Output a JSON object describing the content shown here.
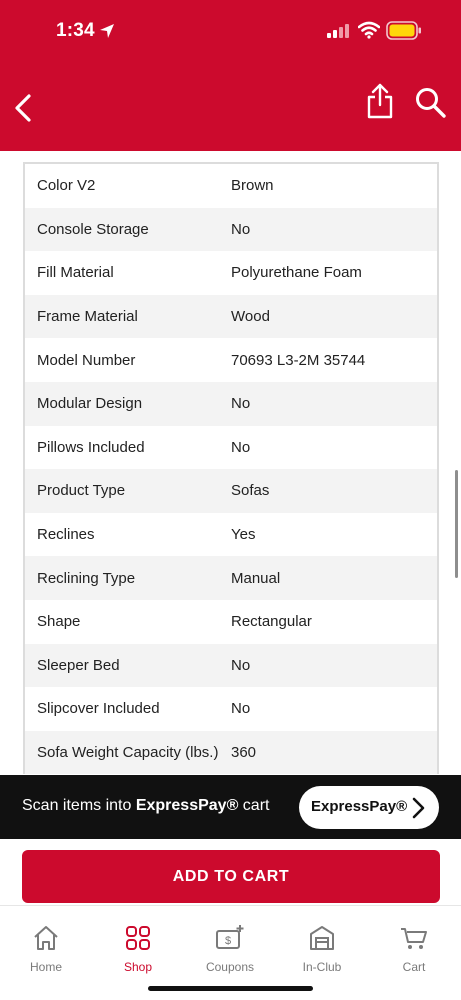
{
  "status_bar": {
    "time": "1:34"
  },
  "specs": [
    {
      "key": "Color V2",
      "value": "Brown"
    },
    {
      "key": "Console Storage",
      "value": "No"
    },
    {
      "key": "Fill Material",
      "value": "Polyurethane Foam"
    },
    {
      "key": "Frame Material",
      "value": "Wood"
    },
    {
      "key": "Model Number",
      "value": "70693 L3-2M 35744"
    },
    {
      "key": "Modular Design",
      "value": "No"
    },
    {
      "key": "Pillows Included",
      "value": "No"
    },
    {
      "key": "Product Type",
      "value": "Sofas"
    },
    {
      "key": "Reclines",
      "value": "Yes"
    },
    {
      "key": "Reclining Type",
      "value": "Manual"
    },
    {
      "key": "Shape",
      "value": "Rectangular"
    },
    {
      "key": "Sleeper Bed",
      "value": "No"
    },
    {
      "key": "Slipcover Included",
      "value": "No"
    },
    {
      "key": "Sofa Weight Capacity (lbs.)",
      "value": "360"
    }
  ],
  "express": {
    "prefix": "Scan items into ",
    "brand": "ExpressPay®",
    "suffix": " cart",
    "button_label": "ExpressPay®"
  },
  "add_to_cart_label": "ADD TO CART",
  "tabs": [
    {
      "label": "Home",
      "icon": "home-icon"
    },
    {
      "label": "Shop",
      "icon": "grid-icon",
      "active": true
    },
    {
      "label": "Coupons",
      "icon": "coupon-icon"
    },
    {
      "label": "In-Club",
      "icon": "store-icon"
    },
    {
      "label": "Cart",
      "icon": "cart-icon"
    }
  ],
  "colors": {
    "brand": "#cc0a2d",
    "banner": "#111111",
    "tab_inactive": "#7a7a7a"
  }
}
